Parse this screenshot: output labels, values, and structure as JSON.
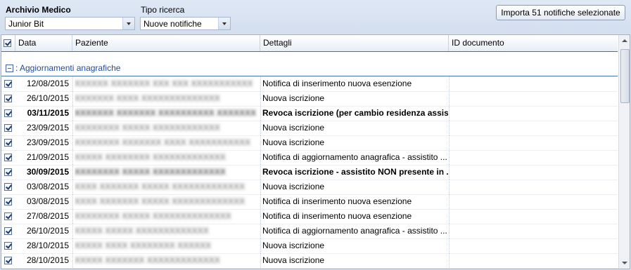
{
  "toolbar": {
    "archive_label": "Archivio Medico",
    "archive_value": "Junior Bit",
    "search_type_label": "Tipo ricerca",
    "search_type_value": "Nuove notifiche",
    "import_button": "Importa 51 notifiche selezionate"
  },
  "grid": {
    "columns": {
      "date": "Data",
      "patient": "Paziente",
      "details": "Dettagli",
      "doc_id": "ID documento"
    },
    "group_label": ": Aggiornamenti anagrafiche",
    "rows": [
      {
        "date": "12/08/2015",
        "patient": "XXXXXX XXXXXXX XXX XXX XXXXXXXXXXX",
        "details": "Notifica di inserimento nuova esenzione",
        "doc_id": "",
        "checked": true,
        "bold": false
      },
      {
        "date": "26/10/2015",
        "patient": "XXXXXXX XXXX XXXXXXXXXXXXXX",
        "details": "Nuova iscrizione",
        "doc_id": "",
        "checked": true,
        "bold": false
      },
      {
        "date": "03/11/2015",
        "patient": "XXXXXXX XXXXXXX XXXXXXXXXX XXXXXXX",
        "details": "Revoca iscrizione (per cambio residenza assist...",
        "doc_id": "",
        "checked": true,
        "bold": true
      },
      {
        "date": "23/09/2015",
        "patient": "XXXXXXXX XXXXX XXXXXXXXXXXX",
        "details": "Nuova iscrizione",
        "doc_id": "",
        "checked": true,
        "bold": false
      },
      {
        "date": "23/09/2015",
        "patient": "XXXXXXXX XXXXXXX XXXX XXXXXXXXXXX",
        "details": "Nuova iscrizione",
        "doc_id": "",
        "checked": true,
        "bold": false
      },
      {
        "date": "21/09/2015",
        "patient": "XXXXX XXXXXXXX XXXXXXXXXXXXX",
        "details": "Notifica di aggiornamento anagrafica - assistito ...",
        "doc_id": "",
        "checked": true,
        "bold": false
      },
      {
        "date": "30/09/2015",
        "patient": "XXXXXXXX XXXXX XXXXXXXXXXXXX",
        "details": "Revoca iscrizione - assistito NON presente in ...",
        "doc_id": "",
        "checked": true,
        "bold": true
      },
      {
        "date": "03/08/2015",
        "patient": "XXXX XXXXXXX XXXXX XXXXXXXXXXXXX",
        "details": "Nuova iscrizione",
        "doc_id": "",
        "checked": true,
        "bold": false
      },
      {
        "date": "03/08/2015",
        "patient": "XXXX XXXXXXX XXXXX XXXXXXXXXXXXX",
        "details": "Notifica di inserimento nuova esenzione",
        "doc_id": "",
        "checked": true,
        "bold": false
      },
      {
        "date": "27/08/2015",
        "patient": "XXXXXXXX XXXXX XXXXXXXXXXXXXX",
        "details": "Notifica di inserimento nuova esenzione",
        "doc_id": "",
        "checked": true,
        "bold": false
      },
      {
        "date": "26/10/2015",
        "patient": "XXXXX XXXXX XXXXXXXXXXXXX",
        "details": "Notifica di aggiornamento anagrafica - assistito ...",
        "doc_id": "",
        "checked": true,
        "bold": false
      },
      {
        "date": "28/10/2015",
        "patient": "XXXXX XXXX XXXXXXXX XXXXXX",
        "details": "Nuova iscrizione",
        "doc_id": "",
        "checked": true,
        "bold": false
      },
      {
        "date": "28/10/2015",
        "patient": "XXXXX XXXXXXX XXXXXXXXXXXXX",
        "details": "Nuova iscrizione",
        "doc_id": "",
        "checked": true,
        "bold": false
      }
    ]
  }
}
